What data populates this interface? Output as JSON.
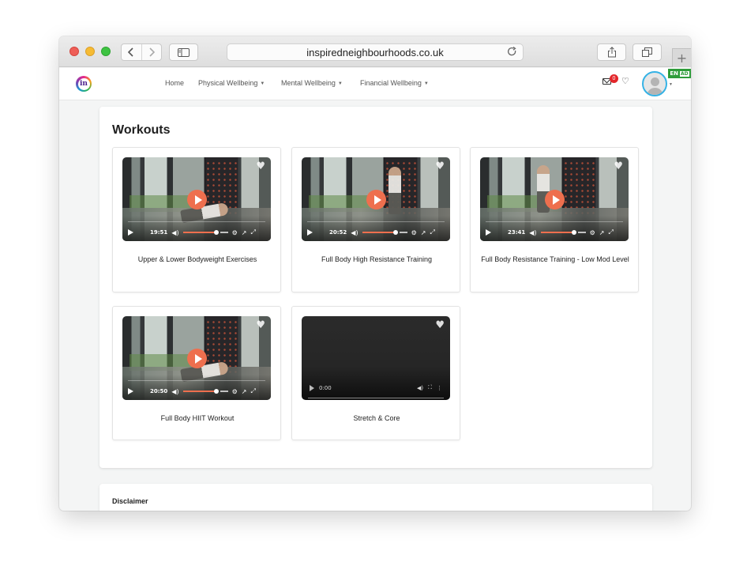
{
  "browser": {
    "url": "inspiredneighbourhoods.co.uk",
    "back_icon": "chevron-left-icon",
    "forward_icon": "chevron-right-icon",
    "new_tab_label": "+"
  },
  "site": {
    "logo_text": "in",
    "nav": [
      {
        "label": "Home",
        "has_dropdown": false
      },
      {
        "label": "Physical Wellbeing",
        "has_dropdown": true
      },
      {
        "label": "Mental Wellbeing",
        "has_dropdown": true
      },
      {
        "label": "Financial Wellbeing",
        "has_dropdown": true
      }
    ],
    "mail_badge": "0",
    "language": "EN",
    "language_tag": "AD",
    "accent": "#ee6f4e",
    "avatar_ring": "#35b2e5"
  },
  "workouts": {
    "title": "Workouts",
    "cards": [
      {
        "title": "Upper & Lower Bodyweight Exercises",
        "duration": "19:51"
      },
      {
        "title": "Full Body High Resistance Training",
        "duration": "20:52"
      },
      {
        "title": "Full Body Resistance Training - Low Mod Level",
        "duration": "23:41"
      },
      {
        "title": "Full Body HIIT Workout",
        "duration": "20:50"
      },
      {
        "title": "Stretch & Core",
        "duration": "0:00"
      }
    ]
  },
  "disclaimer": {
    "title": "Disclaimer"
  }
}
